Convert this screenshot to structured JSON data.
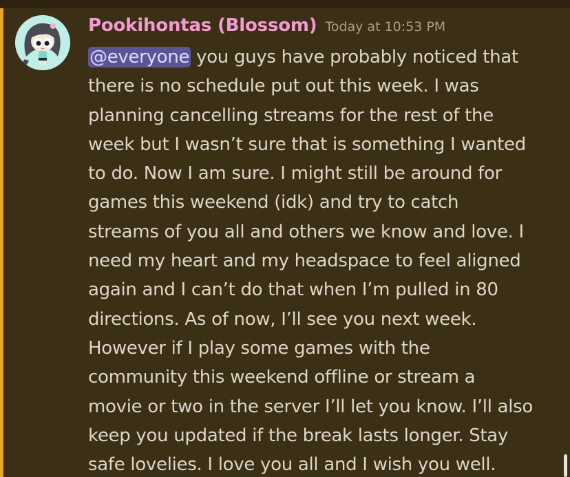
{
  "message": {
    "username": "Pookihontas (Blossom)",
    "timestamp": "Today at 10:53 PM",
    "mention": "@everyone",
    "lines": [
      " you guys have probably noticed that",
      "there is no schedule put out this week. I was",
      "planning cancelling streams for the rest of the",
      "week but I wasn’t sure that is something I wanted",
      "to do. Now I am sure. I might still be around for",
      "games this weekend (idk) and try to catch",
      "streams of you all and others we know and love. I",
      "need my heart and my headspace to feel aligned",
      "again and I can’t do that when I’m pulled in 80",
      "directions. As of now, I’ll see you next week.",
      "However if I play some games with the",
      "community this  weekend offline or stream a",
      "movie or two in the server I’ll let you know. I’ll also",
      "keep you updated if the break lasts longer. Stay",
      "safe lovelies. I love you all and I wish you well."
    ]
  },
  "colors": {
    "background": "#3b2f16",
    "highlight_bar": "#e8a631",
    "username": "#f49ad2",
    "mention_bg": "#5b5597"
  },
  "icons": {
    "avatar": "powerpuff-girl-avatar"
  }
}
